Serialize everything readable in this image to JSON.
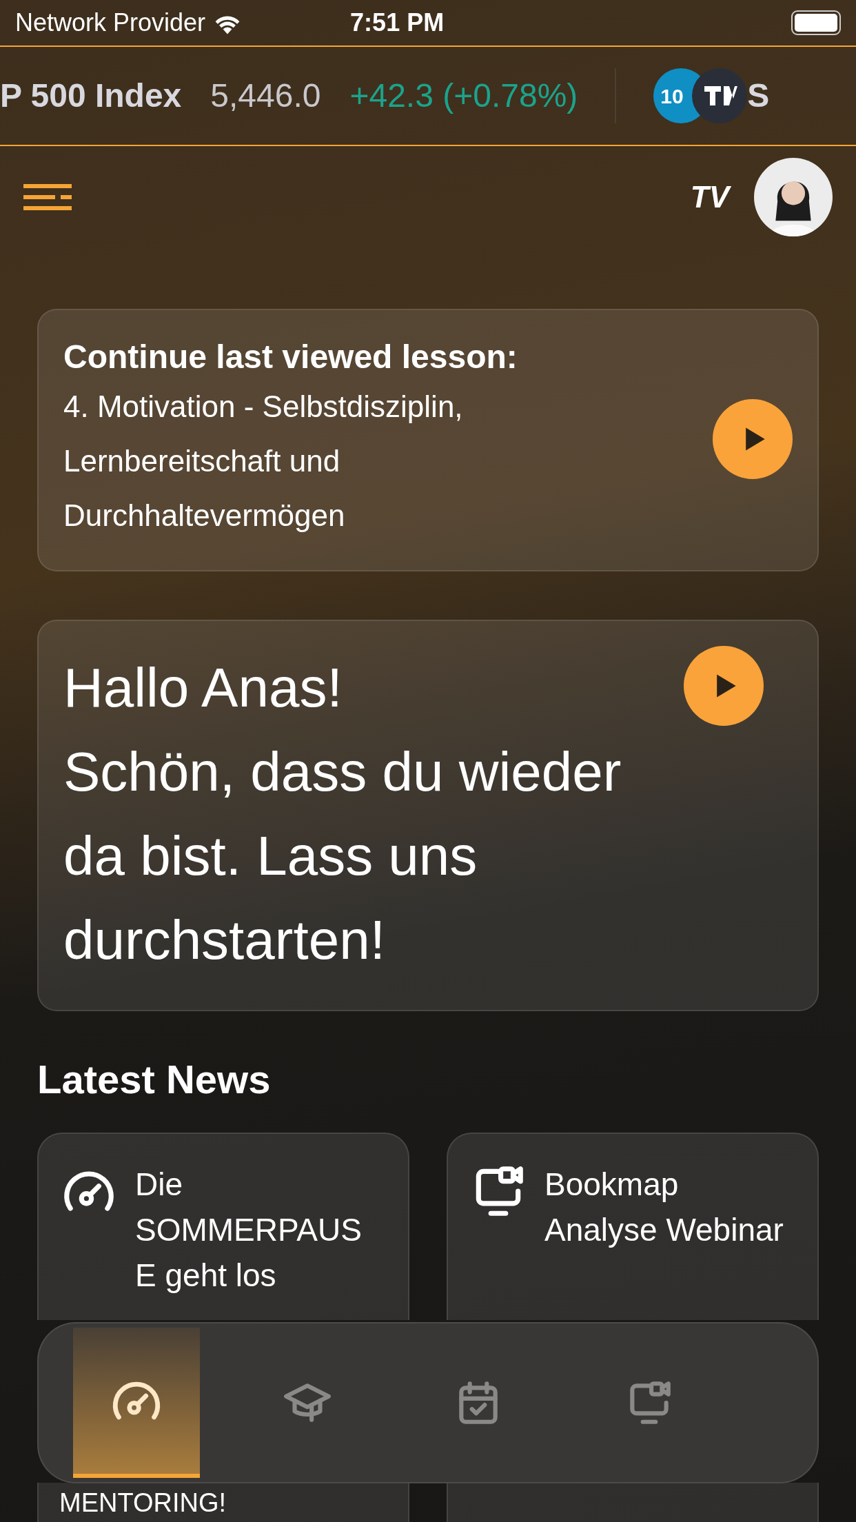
{
  "status_bar": {
    "carrier": "Network Provider",
    "time": "7:51 PM"
  },
  "ticker": {
    "items": [
      {
        "name": "P 500 Index",
        "price": "5,446.0",
        "change": "+42.3 (+0.78%)"
      }
    ],
    "next_badge": "10",
    "next_name": "S"
  },
  "header": {
    "logo": "TV"
  },
  "continue_card": {
    "title": "Continue last viewed lesson:",
    "lesson": "4. Motivation - Selbstdisziplin, Lernbereitschaft und Durchhaltevermögen"
  },
  "welcome_card": {
    "message": "Hallo Anas!\nSchön, dass du wieder da bist. Lass uns durchstarten!"
  },
  "news": {
    "title": "Latest News",
    "items": [
      {
        "kind": "dashboard",
        "title": "Die SOMMERPAUSE geht los",
        "tail": "MENTORING!"
      },
      {
        "kind": "webinar",
        "title": "Bookmap Analyse Webinar"
      }
    ]
  },
  "tab_bar": [
    {
      "kind": "dashboard",
      "selected": true
    },
    {
      "kind": "courses",
      "selected": false
    },
    {
      "kind": "calendar",
      "selected": false
    },
    {
      "kind": "webinar",
      "selected": false
    }
  ]
}
